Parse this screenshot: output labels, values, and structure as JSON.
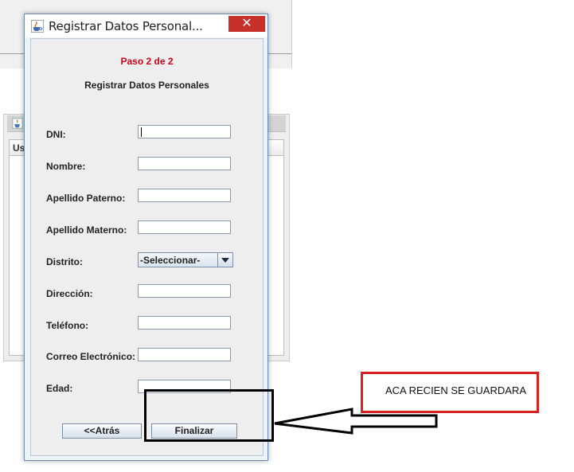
{
  "background": {
    "table_header": "Us"
  },
  "dialog": {
    "title": "Registrar Datos Personal...",
    "close_symbol": "✕",
    "step": "Paso 2 de 2",
    "heading": "Registrar Datos Personales",
    "fields": [
      {
        "label": "DNI:",
        "value": ""
      },
      {
        "label": "Nombre:",
        "value": ""
      },
      {
        "label": "Apellido Paterno:",
        "value": ""
      },
      {
        "label": "Apellido Materno:",
        "value": ""
      },
      {
        "label": "Distrito:",
        "value": "-Seleccionar-"
      },
      {
        "label": "Dirección:",
        "value": ""
      },
      {
        "label": "Teléfono:",
        "value": ""
      },
      {
        "label": "Correo Electrónico:",
        "value": ""
      },
      {
        "label": "Edad:",
        "value": ""
      }
    ],
    "back_label": "<<Atrás",
    "finish_label": "Finalizar"
  },
  "annotation": {
    "note": "ACA RECIEN SE GUARDARA"
  },
  "colors": {
    "step_color": "#d0021b",
    "close_button": "#c7302b",
    "annotation_red": "#d82020"
  },
  "icons": [
    "java-cup-icon",
    "minimize-icon",
    "maximize-icon",
    "close-icon",
    "chevron-down-icon",
    "arrow-left-icon"
  ]
}
